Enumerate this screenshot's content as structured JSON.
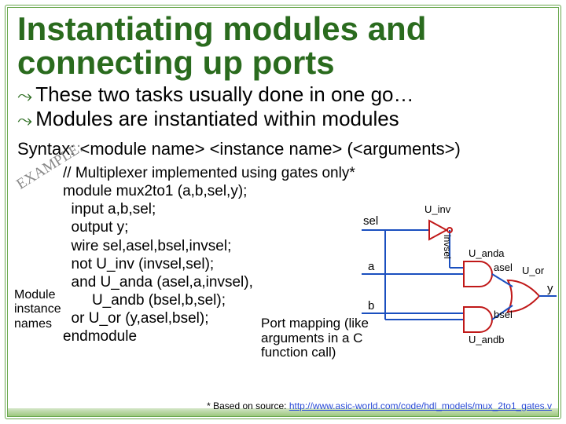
{
  "title": "Instantiating modules and connecting up ports",
  "bullets": [
    "These two tasks usually done in one go…",
    "Modules are instantiated within modules"
  ],
  "syntax": "Syntax:  <module name> <instance name>  (<arguments>)",
  "stamp": "EXAMPLE:",
  "code_lines": [
    "// Multiplexer implemented using gates only*",
    "module mux2to1 (a,b,sel,y);",
    "  input a,b,sel;",
    "  output y;",
    "  wire sel,asel,bsel,invsel;",
    "  not U_inv (invsel,sel);",
    "  and U_anda (asel,a,invsel),",
    "       U_andb (bsel,b,sel);",
    "  or U_or (y,asel,bsel);",
    "endmodule"
  ],
  "annot": {
    "l1": "Module",
    "l2": "instance",
    "l3": "names"
  },
  "portnote": {
    "l1": "Port mapping (like",
    "l2": "arguments in a  C",
    "l3": "function call)"
  },
  "diagram": {
    "sel": "sel",
    "a": "a",
    "b": "b",
    "y": "y",
    "u_inv": "U_inv",
    "invsel": "invsel",
    "u_anda": "U_anda",
    "asel": "asel",
    "u_andb": "U_andb",
    "bsel": "bsel",
    "u_or": "U_or"
  },
  "footnote": {
    "pre": "* Based on source: ",
    "url": "http://www.asic-world.com/code/hdl_models/mux_2to1_gates.v"
  }
}
